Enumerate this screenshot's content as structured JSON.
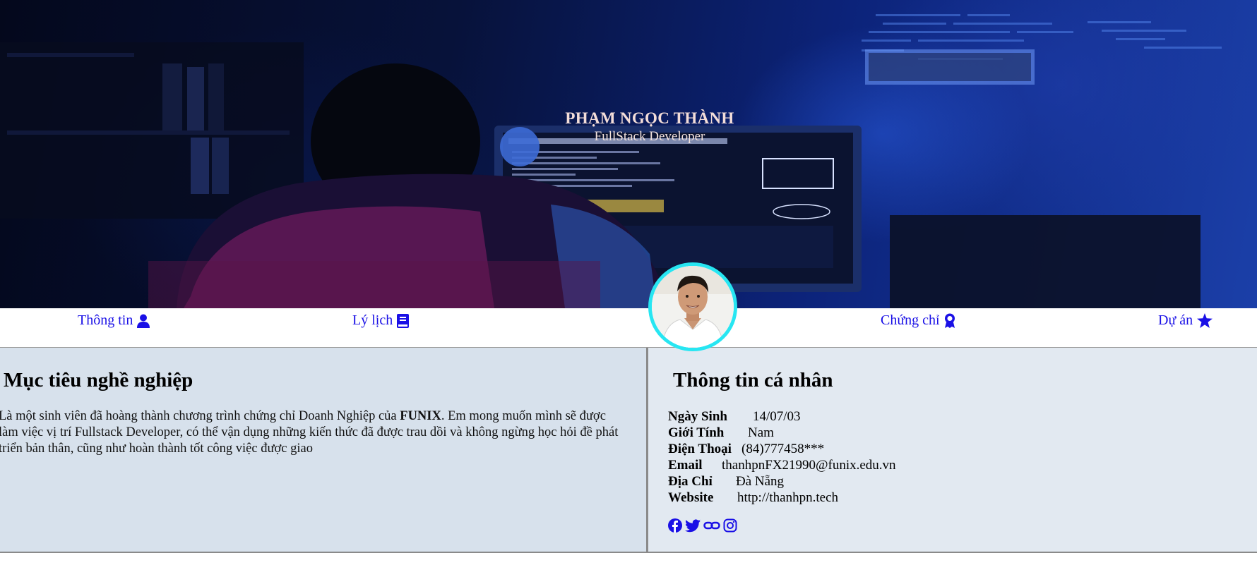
{
  "hero": {
    "name": "PHẠM NGỌC THÀNH",
    "role": "FullStack Developer"
  },
  "nav": {
    "items": [
      {
        "label": "Thông tin",
        "icon": "user-icon"
      },
      {
        "label": "Lý lịch",
        "icon": "book-icon"
      },
      {
        "label": "Chứng chỉ",
        "icon": "award-icon"
      },
      {
        "label": "Dự án",
        "icon": "star-icon"
      }
    ],
    "link_color": "#1a10e6"
  },
  "avatar": {
    "icon": "profile-photo",
    "border_color": "#27e6f2"
  },
  "objective": {
    "title": "Mục tiêu nghề nghiệp",
    "text_before": "Là một sinh viên đã hoàng thành chương trình chứng chỉ Doanh Nghiệp của ",
    "brand": "FUNIX",
    "text_after": ". Em mong muốn mình sẽ được làm việc vị trí Fullstack Developer, có thể vận dụng những kiến thức đã được trau dồi và không ngừng học hỏi đề phát triển bản thân, cũng như hoàn thành tốt công việc được giao"
  },
  "personal": {
    "title": "Thông tin cá nhân",
    "fields": [
      {
        "label": "Ngày Sinh",
        "value": "14/07/03"
      },
      {
        "label": "Giới Tính",
        "value": "Nam"
      },
      {
        "label": "Điện Thoại",
        "value": "(84)777458***"
      },
      {
        "label": "Email",
        "value": "thanhpnFX21990@funix.edu.vn"
      },
      {
        "label": "Địa Chỉ",
        "value": "Đà Nẵng"
      },
      {
        "label": "Website",
        "value": "http://thanhpn.tech"
      }
    ],
    "socials": [
      "facebook-icon",
      "twitter-icon",
      "link-icon",
      "instagram-icon"
    ]
  },
  "colors": {
    "left_panel": "#d7e1ec",
    "right_panel": "#e2e9f1",
    "hero_bg": "#0c237a"
  }
}
